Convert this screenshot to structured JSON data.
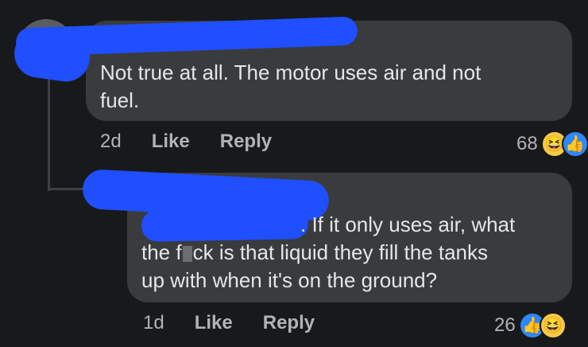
{
  "colors": {
    "background": "#18191a",
    "bubble": "#3a3b3c",
    "scribble": "#1f4fff",
    "like_blue": "#2d88ff",
    "haha_yellow": "#f7c948"
  },
  "comment1": {
    "text_line1": "Not true at all. The motor uses air and not",
    "text_line2": "fuel.",
    "time": "2d",
    "like_label": "Like",
    "reply_label": "Reply",
    "reaction_count": "68",
    "reaction_icons": [
      "haha-icon",
      "like-icon"
    ]
  },
  "comment2": {
    "text_line1": ". If it only uses air, what",
    "text_line2_a": "the f",
    "text_line2_b": "ck is that liquid they fill the tanks",
    "text_line3": "up with when it's on the ground?",
    "time": "1d",
    "like_label": "Like",
    "reply_label": "Reply",
    "reaction_count": "26",
    "reaction_icons": [
      "like-icon",
      "haha-icon"
    ]
  }
}
